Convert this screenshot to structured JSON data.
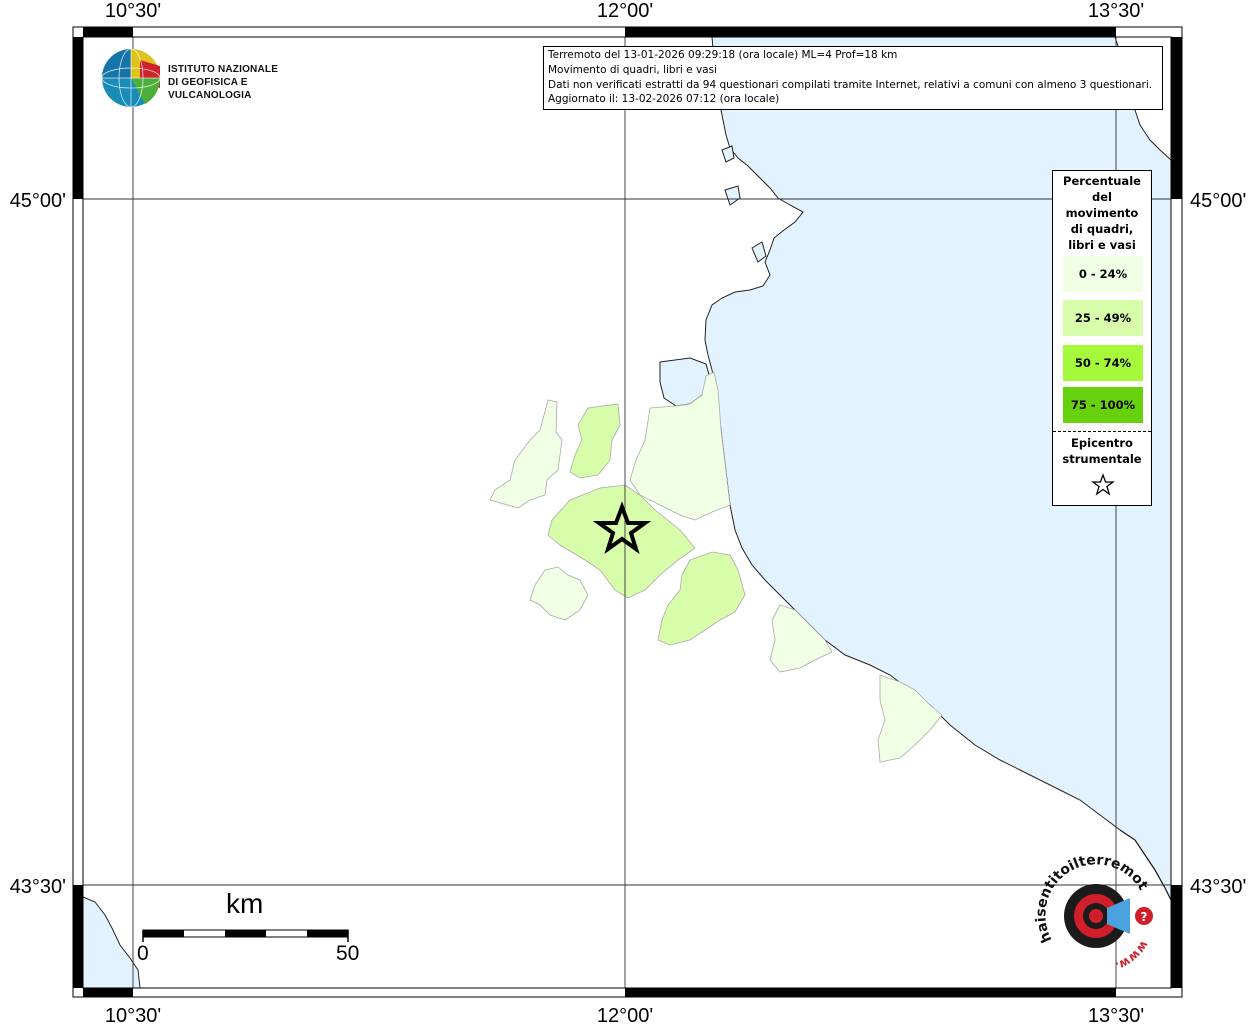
{
  "map": {
    "colors": {
      "sea": "#e2f2fe",
      "land": "#ffffff",
      "coast": "#222222",
      "class_0_24": "#f1ffe5",
      "class_25_49": "#d7fdaa",
      "class_50_74": "#a5f83a",
      "class_75_100": "#66d10c"
    },
    "top_lon_labels": [
      "10°30'",
      "12°00'",
      "13°30'"
    ],
    "bottom_lon_labels": [
      "10°30'",
      "12°00'",
      "13°30'"
    ],
    "left_lat_labels": [
      "45°00'",
      "43°30'"
    ],
    "right_lat_labels": [
      "45°00'",
      "43°30'"
    ]
  },
  "logo": {
    "line1": "ISTITUTO NAZIONALE",
    "line2": "DI GEOFISICA E VULCANOLOGIA"
  },
  "info": {
    "line1": "Terremoto del 13-01-2026 09:29:18 (ora locale) ML=4 Prof=18 km",
    "line2": "Movimento di quadri, libri e vasi",
    "line3": "Dati non verificati estratti da 94 questionari compilati tramite Internet, relativi a comuni con almeno 3 questionari.",
    "line4": "Aggiornato il: 13-02-2026 07:12 (ora locale)"
  },
  "legend": {
    "title_lines": [
      "Percentuale",
      "del",
      "movimento",
      "di quadri,",
      "libri e vasi"
    ],
    "classes": [
      {
        "label": "0 - 24%",
        "color": "#f1ffe5"
      },
      {
        "label": "25 - 49%",
        "color": "#d7fdaa"
      },
      {
        "label": "50 - 74%",
        "color": "#a5f83a"
      },
      {
        "label": "75 - 100%",
        "color": "#66d10c"
      }
    ],
    "epicenter_lines": [
      "Epicentro",
      "strumentale"
    ],
    "epicenter_icon": "star-outline-icon"
  },
  "scalebar": {
    "unit": "km",
    "min_label": "0",
    "max_label": "50"
  },
  "haisentito": {
    "text": "haisentitoilterremoto.it",
    "url": "www.",
    "icon": "megaphone-icon"
  }
}
